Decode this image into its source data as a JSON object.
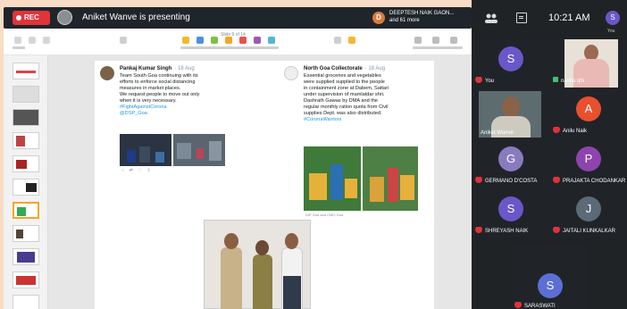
{
  "meeting": {
    "rec_label": "REC",
    "presenter_text": "Aniket Wanve is presenting",
    "host_initial": "D",
    "host_name_line1": "DEEPTESH NAIK GAON...",
    "host_name_line2": "and 61 more",
    "time": "10:21 AM",
    "you_initial": "S",
    "you_label": "You"
  },
  "participants": [
    {
      "name": "You",
      "initial": "S",
      "color": "#6a57c8",
      "muted": true
    },
    {
      "name": "Aniket Wanve",
      "initial": "",
      "color": "",
      "muted": false,
      "video": true
    },
    {
      "name": "nasha qhi",
      "initial": "",
      "color": "",
      "muted": false,
      "video": true
    },
    {
      "name": "Anilu Naik",
      "initial": "A",
      "color": "#e8502e",
      "muted": true
    },
    {
      "name": "GERMANO D'COSTA",
      "initial": "G",
      "color": "#8a7bbf",
      "muted": true
    },
    {
      "name": "PRAJAKTA CHODANKAR",
      "initial": "P",
      "color": "#8e44ad",
      "muted": true
    },
    {
      "name": "SHREYASH NAIK",
      "initial": "S",
      "color": "#6a57c8",
      "muted": true
    },
    {
      "name": "JAITALI KUNKALKAR",
      "initial": "J",
      "color": "#5c6a78",
      "muted": true
    },
    {
      "name": "SARASWATI",
      "initial": "S",
      "color": "#5b6fd6",
      "muted": true
    }
  ],
  "slide": {
    "tweet1": {
      "name": "Pankaj Kumar Singh",
      "date": "· 18 Aug",
      "lines": [
        "Team South Goa continuing with its",
        "efforts to enforce social distancing",
        "measures in market places.",
        "We request people to move out only",
        "when it is very necessary."
      ],
      "tags": [
        "#FightAgainstCorona",
        "@DSP_Goa"
      ]
    },
    "tweet2": {
      "name": "North Goa Collectorate",
      "date": "· 18 Aug",
      "lines": [
        "Essential groceries and vegetables",
        "were supplied supplied to the people",
        "in containment zone at Dabem, Sattari",
        "under supervision of mamlatdar shri.",
        "Dashrath Gawas by DMA and the",
        "regular monthly ration quota from Civil",
        "supplies Dept. was also distributed."
      ],
      "tags": [
        "#CoronaWarriors"
      ],
      "caption": "DIP Goa and CMO Goa"
    }
  },
  "toolbar": {
    "title": "Slide 9 of 14"
  }
}
